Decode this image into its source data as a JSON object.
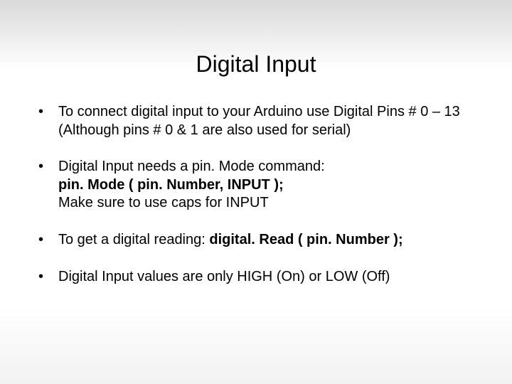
{
  "title": "Digital Input",
  "bullets": {
    "b1": "To connect digital input to your Arduino use Digital Pins # 0 – 13  (Although pins # 0 & 1 are also used for serial)",
    "b2": {
      "line1": "Digital Input needs a pin. Mode command:",
      "line2": "pin. Mode ( pin. Number, INPUT );",
      "line3": "Make sure to use caps for INPUT"
    },
    "b3": {
      "prefix": "To get a digital reading: ",
      "code": "digital. Read ( pin. Number );"
    },
    "b4": "Digital Input values are only HIGH (On) or LOW (Off)"
  }
}
